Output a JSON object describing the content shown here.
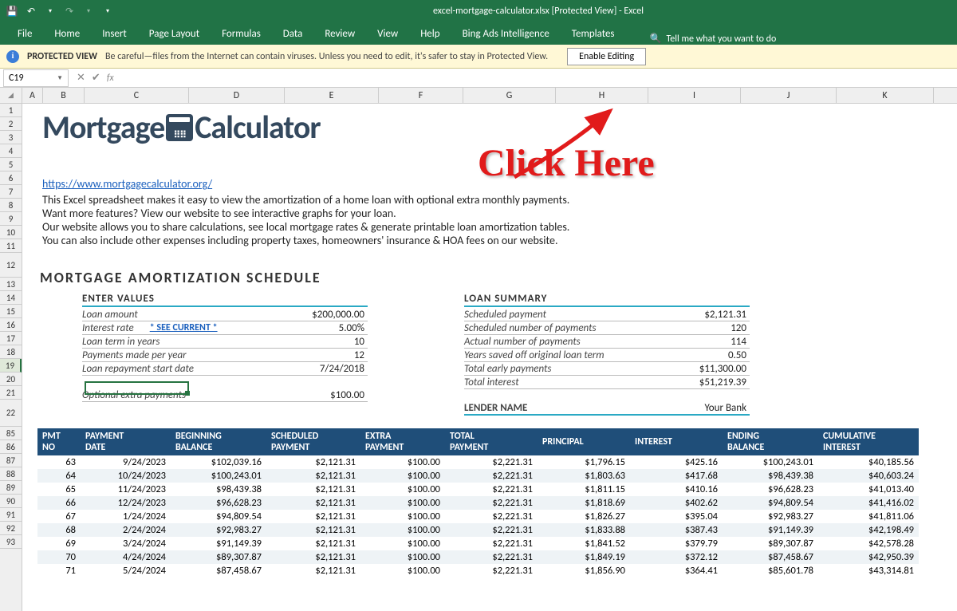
{
  "title": "excel-mortgage-calculator.xlsx  [Protected View]  -  Excel",
  "ribbon": [
    "File",
    "Home",
    "Insert",
    "Page Layout",
    "Formulas",
    "Data",
    "Review",
    "View",
    "Help",
    "Bing Ads Intelligence",
    "Templates"
  ],
  "tellme": "Tell me what you want to do",
  "protected_view": {
    "title": "PROTECTED VIEW",
    "msg": "Be careful—files from the Internet can contain viruses. Unless you need to edit, it's safer to stay in Protected View.",
    "enable": "Enable Editing"
  },
  "namebox": "C19",
  "columns": [
    "A",
    "B",
    "C",
    "D",
    "E",
    "F",
    "G",
    "H",
    "I",
    "J",
    "K"
  ],
  "left_rows": [
    "1",
    "2",
    "3",
    "4",
    "5",
    "6",
    "7",
    "8",
    "9",
    "10",
    "11",
    "12",
    "13",
    "14",
    "15",
    "16",
    "17",
    "18",
    "19",
    "20",
    "21",
    "22",
    "85",
    "86",
    "87",
    "88",
    "89",
    "90",
    "91",
    "92",
    "93"
  ],
  "logo1": "Mortgage",
  "logo2": "Calculator",
  "url": "https://www.mortgagecalculator.org/",
  "desc": [
    "This Excel spreadsheet makes it easy to view the amortization of a home loan with optional extra monthly payments.",
    "Want more features? View our website to see interactive graphs for your loan.",
    "Our website allows you to share calculations, see local mortgage rates & generate printable loan amortization tables.",
    "You can also include other expenses including property taxes, homeowners' insurance & HOA fees on our website."
  ],
  "section_title": "MORTGAGE AMORTIZATION SCHEDULE",
  "enter_values": {
    "title": "ENTER VALUES",
    "rows": [
      {
        "lbl": "Loan amount",
        "val": "$200,000.00"
      },
      {
        "lbl": "Interest rate",
        "see": "* SEE CURRENT *",
        "val": "5.00%"
      },
      {
        "lbl": "Loan term in years",
        "val": "10"
      },
      {
        "lbl": "Payments made per year",
        "val": "12"
      },
      {
        "lbl": "Loan repayment start date",
        "val": "7/24/2018"
      }
    ],
    "extra_lbl": "Optional extra payments",
    "extra_val": "$100.00"
  },
  "loan_summary": {
    "title": "LOAN SUMMARY",
    "rows": [
      {
        "lbl": "Scheduled payment",
        "val": "$2,121.31"
      },
      {
        "lbl": "Scheduled number of payments",
        "val": "120"
      },
      {
        "lbl": "Actual number of payments",
        "val": "114"
      },
      {
        "lbl": "Years saved off original loan term",
        "val": "0.50"
      },
      {
        "lbl": "Total early payments",
        "val": "$11,300.00"
      },
      {
        "lbl": "Total interest",
        "val": "$51,219.39"
      }
    ],
    "lender_lbl": "LENDER NAME",
    "lender_val": "Your Bank"
  },
  "amort_hdr": {
    "pmtno": [
      "PMT",
      "NO"
    ],
    "date": [
      "PAYMENT",
      "DATE"
    ],
    "beg": [
      "BEGINNING",
      "BALANCE"
    ],
    "sched": [
      "SCHEDULED",
      "PAYMENT"
    ],
    "extra": [
      "EXTRA",
      "PAYMENT"
    ],
    "total": [
      "TOTAL",
      "PAYMENT"
    ],
    "princ": "PRINCIPAL",
    "int": "INTEREST",
    "end": [
      "ENDING",
      "BALANCE"
    ],
    "cum": [
      "CUMULATIVE",
      "INTEREST"
    ]
  },
  "amort": [
    {
      "no": "63",
      "date": "9/24/2023",
      "beg": "$102,039.16",
      "sched": "$2,121.31",
      "extra": "$100.00",
      "total": "$2,221.31",
      "princ": "$1,796.15",
      "int": "$425.16",
      "end": "$100,243.01",
      "cum": "$40,185.56"
    },
    {
      "no": "64",
      "date": "10/24/2023",
      "beg": "$100,243.01",
      "sched": "$2,121.31",
      "extra": "$100.00",
      "total": "$2,221.31",
      "princ": "$1,803.63",
      "int": "$417.68",
      "end": "$98,439.38",
      "cum": "$40,603.24"
    },
    {
      "no": "65",
      "date": "11/24/2023",
      "beg": "$98,439.38",
      "sched": "$2,121.31",
      "extra": "$100.00",
      "total": "$2,221.31",
      "princ": "$1,811.15",
      "int": "$410.16",
      "end": "$96,628.23",
      "cum": "$41,013.40"
    },
    {
      "no": "66",
      "date": "12/24/2023",
      "beg": "$96,628.23",
      "sched": "$2,121.31",
      "extra": "$100.00",
      "total": "$2,221.31",
      "princ": "$1,818.69",
      "int": "$402.62",
      "end": "$94,809.54",
      "cum": "$41,416.02"
    },
    {
      "no": "67",
      "date": "1/24/2024",
      "beg": "$94,809.54",
      "sched": "$2,121.31",
      "extra": "$100.00",
      "total": "$2,221.31",
      "princ": "$1,826.27",
      "int": "$395.04",
      "end": "$92,983.27",
      "cum": "$41,811.06"
    },
    {
      "no": "68",
      "date": "2/24/2024",
      "beg": "$92,983.27",
      "sched": "$2,121.31",
      "extra": "$100.00",
      "total": "$2,221.31",
      "princ": "$1,833.88",
      "int": "$387.43",
      "end": "$91,149.39",
      "cum": "$42,198.49"
    },
    {
      "no": "69",
      "date": "3/24/2024",
      "beg": "$91,149.39",
      "sched": "$2,121.31",
      "extra": "$100.00",
      "total": "$2,221.31",
      "princ": "$1,841.52",
      "int": "$379.79",
      "end": "$89,307.87",
      "cum": "$42,578.28"
    },
    {
      "no": "70",
      "date": "4/24/2024",
      "beg": "$89,307.87",
      "sched": "$2,121.31",
      "extra": "$100.00",
      "total": "$2,221.31",
      "princ": "$1,849.19",
      "int": "$372.12",
      "end": "$87,458.67",
      "cum": "$42,950.39"
    },
    {
      "no": "71",
      "date": "5/24/2024",
      "beg": "$87,458.67",
      "sched": "$2,121.31",
      "extra": "$100.00",
      "total": "$2,221.31",
      "princ": "$1,856.90",
      "int": "$364.41",
      "end": "$85,601.78",
      "cum": "$43,314.81"
    }
  ],
  "click_here": "Click Here"
}
